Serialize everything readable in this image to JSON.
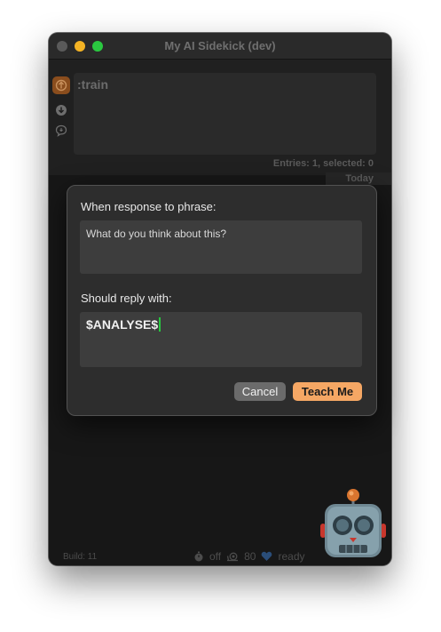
{
  "window": {
    "title": "My AI Sidekick (dev)"
  },
  "sidebar": {
    "items": [
      {
        "icon": "sidekick-icon",
        "active": true
      },
      {
        "icon": "download-icon",
        "active": false
      },
      {
        "icon": "speech-bubble-icon",
        "active": false
      }
    ]
  },
  "command": {
    "value": ":train"
  },
  "list": {
    "entries_summary": "Entries: 1, selected: 0",
    "group_header": "Today"
  },
  "dialog": {
    "phrase_label": "When response to phrase:",
    "phrase_value": "What do you think about this?",
    "reply_label": "Should reply with:",
    "reply_value": "$ANALYSE$",
    "cancel_label": "Cancel",
    "teach_label": "Teach Me",
    "colors": {
      "accent": "#f5a764",
      "caret": "#28c840"
    }
  },
  "status": {
    "build": "Build: 11",
    "timer_state": "off",
    "value": "80",
    "state": "ready"
  }
}
